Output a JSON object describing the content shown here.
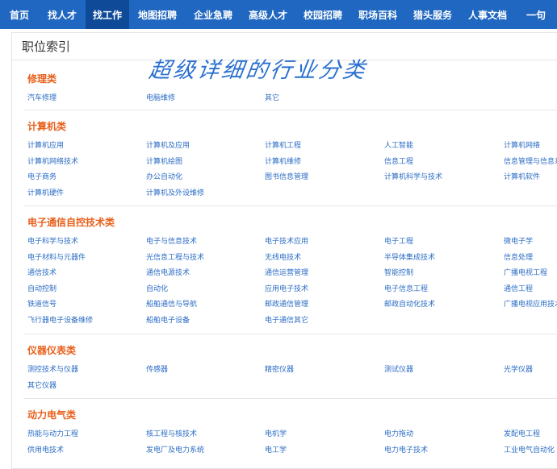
{
  "nav": {
    "items": [
      "首页",
      "找人才",
      "找工作",
      "地图招聘",
      "企业急聘",
      "高级人才",
      "校园招聘",
      "职场百科",
      "猎头服务",
      "人事文档",
      "一句"
    ],
    "active_index": 2
  },
  "panel": {
    "title": "职位索引"
  },
  "banner": {
    "text": "超级详细的行业分类"
  },
  "colors": {
    "nav_bg": "#1f67c0",
    "nav_active": "#0f4a98",
    "section_title": "#e8601b",
    "link": "#2b6cc4"
  },
  "sections": [
    {
      "title": "修理类",
      "links": [
        "汽车修理",
        "电脑维修",
        "其它"
      ]
    },
    {
      "title": "计算机类",
      "links": [
        "计算机应用",
        "计算机及应用",
        "计算机工程",
        "人工智能",
        "计算机网络",
        "计算机网络技术",
        "计算机绘图",
        "计算机维修",
        "信息工程",
        "信息管理与信息系统",
        "电子商务",
        "办公自动化",
        "图书信息管理",
        "计算机科学与技术",
        "计算机软件",
        "计算机硬件",
        "计算机及外设维修"
      ]
    },
    {
      "title": "电子通信自控技术类",
      "links": [
        "电子科学与技术",
        "电子与信息技术",
        "电子技术应用",
        "电子工程",
        "微电子学",
        "电子材料与元器件",
        "光信息工程与技术",
        "无线电技术",
        "半导体集成技术",
        "信息处理",
        "通信技术",
        "通信电源技术",
        "通信运营管理",
        "智能控制",
        "广播电视工程",
        "自动控制",
        "自动化",
        "应用电子技术",
        "电子信息工程",
        "通信工程",
        "铁道信号",
        "船舶通信与导航",
        "邮政通信管理",
        "邮政自动化技术",
        "广播电视应用技术",
        "飞行器电子设备维修",
        "船舶电子设备",
        "电子通信其它"
      ]
    },
    {
      "title": "仪器仪表类",
      "links": [
        "测控技术与仪器",
        "传感器",
        "精密仪器",
        "测试仪器",
        "光学仪器",
        "其它仪器"
      ]
    },
    {
      "title": "动力电气类",
      "links": [
        "热能与动力工程",
        "核工程与核技术",
        "电机学",
        "电力拖动",
        "发配电工程",
        "供用电技术",
        "发电厂及电力系统",
        "电工学",
        "电力电子技术",
        "工业电气自动化"
      ]
    }
  ]
}
